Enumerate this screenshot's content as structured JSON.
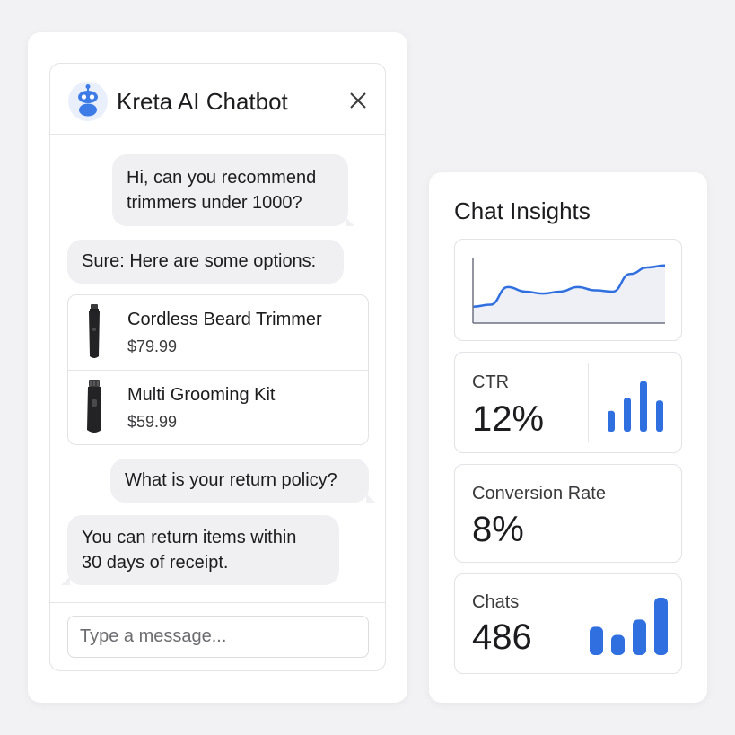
{
  "chatbot": {
    "title": "Kreta AI Chatbot",
    "avatar_icon": "robot-icon",
    "close_icon": "close-icon",
    "messages": [
      {
        "from": "user",
        "text": "Hi, can you recommend\ntrimmers under 1000?"
      },
      {
        "from": "bot",
        "text": "Sure: Here are some options:"
      },
      {
        "from": "user",
        "text": "What is your return policy?"
      },
      {
        "from": "bot",
        "text": "You can return items within\n30 days of receipt."
      }
    ],
    "products": [
      {
        "name": "Cordless Beard Trimmer",
        "price": "$79.99",
        "icon": "beard-trimmer-icon"
      },
      {
        "name": "Multi Grooming Kit",
        "price": "$59.99",
        "icon": "grooming-kit-icon"
      }
    ],
    "input": {
      "placeholder": "Type a message...",
      "value": ""
    }
  },
  "insights": {
    "title": "Chat Insights",
    "trend_chart": {
      "type": "line",
      "values": [
        0.25,
        0.28,
        0.55,
        0.48,
        0.45,
        0.48,
        0.55,
        0.5,
        0.48,
        0.75,
        0.85,
        0.88
      ]
    },
    "metrics": [
      {
        "label": "CTR",
        "value": "12%",
        "bars": [
          0.4,
          0.65,
          0.97,
          0.6
        ]
      },
      {
        "label": "Conversion Rate",
        "value": "8%"
      },
      {
        "label": "Chats",
        "value": "486",
        "bars": [
          0.48,
          0.34,
          0.6,
          0.97
        ]
      }
    ]
  },
  "colors": {
    "accent": "#2f6fe0",
    "bubble": "#f0f0f3",
    "chart_fill": "#eef0f6",
    "axis": "#6f7380"
  }
}
